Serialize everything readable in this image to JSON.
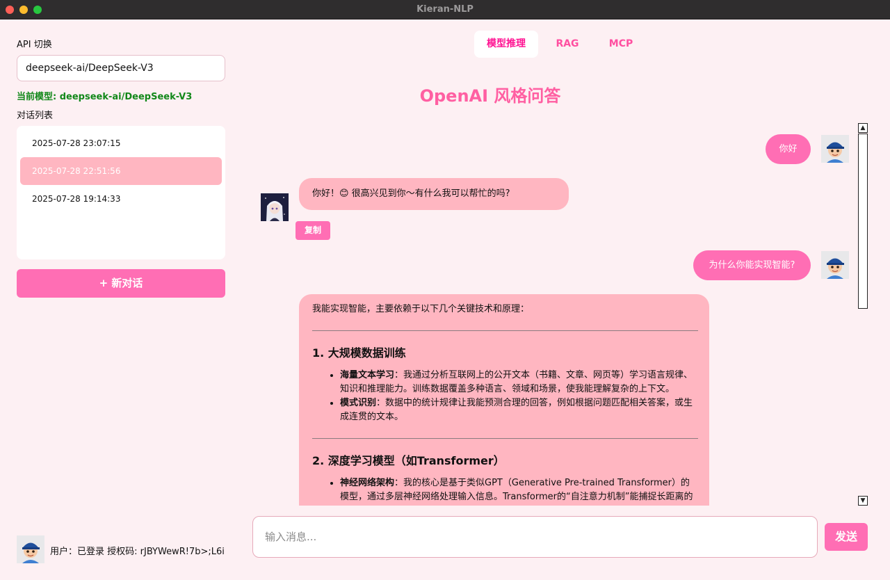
{
  "window": {
    "title": "Kieran-NLP"
  },
  "sidebar": {
    "api_label": "API 切换",
    "api_value": "deepseek-ai/DeepSeek-V3",
    "current_model": "当前模型: deepseek-ai/DeepSeek-V3",
    "conversations_label": "对话列表",
    "conversations": [
      {
        "label": "2025-07-28 23:07:15",
        "active": false
      },
      {
        "label": "2025-07-28 22:51:56",
        "active": true
      },
      {
        "label": "2025-07-28 19:14:33",
        "active": false
      }
    ],
    "new_chat": "+ 新对话",
    "user_info": "用户：已登录 授权码: rJBYWewR!7b>;L6i"
  },
  "tabs": [
    {
      "label": "模型推理",
      "active": true
    },
    {
      "label": "RAG",
      "active": false
    },
    {
      "label": "MCP",
      "active": false
    }
  ],
  "heading": "OpenAI 风格问答",
  "chat": {
    "messages": [
      {
        "role": "user",
        "text": "你好"
      },
      {
        "role": "assistant",
        "text": "你好！😊 很高兴见到你～有什么我可以帮忙的吗?"
      },
      {
        "role": "user",
        "text": "为什么你能实现智能?"
      }
    ],
    "copy_label": "复制",
    "long_reply": {
      "intro": "我能实现智能，主要依赖于以下几个关键技术和原理：",
      "section1_title": "1. 大规模数据训练",
      "s1_item1_bold": "海量文本学习",
      "s1_item1_text": "：我通过分析互联网上的公开文本（书籍、文章、网页等）学习语言规律、知识和推理能力。训练数据覆盖多种语言、领域和场景，使我能理解复杂的上下文。",
      "s1_item2_bold": "模式识别",
      "s1_item2_text": "：数据中的统计规律让我能预测合理的回答，例如根据问题匹配相关答案，或生成连贯的文本。",
      "section2_title": "2. 深度学习模型（如Transformer）",
      "s2_item1_bold": "神经网络架构",
      "s2_item1_text": "：我的核心是基于类似GPT（Generative Pre-trained Transformer）的模型，通过多层神经网络处理输入信息。Transformer的“自注意力机制”能捕捉长距离的词语依赖关系，从而理解上下文。"
    }
  },
  "input": {
    "placeholder": "输入消息...",
    "send_label": "发送"
  },
  "colors": {
    "accent": "#ff6eb4",
    "bubble_bot": "#ffb6c1",
    "background": "#fdf0f3",
    "model_text": "#12881a"
  }
}
